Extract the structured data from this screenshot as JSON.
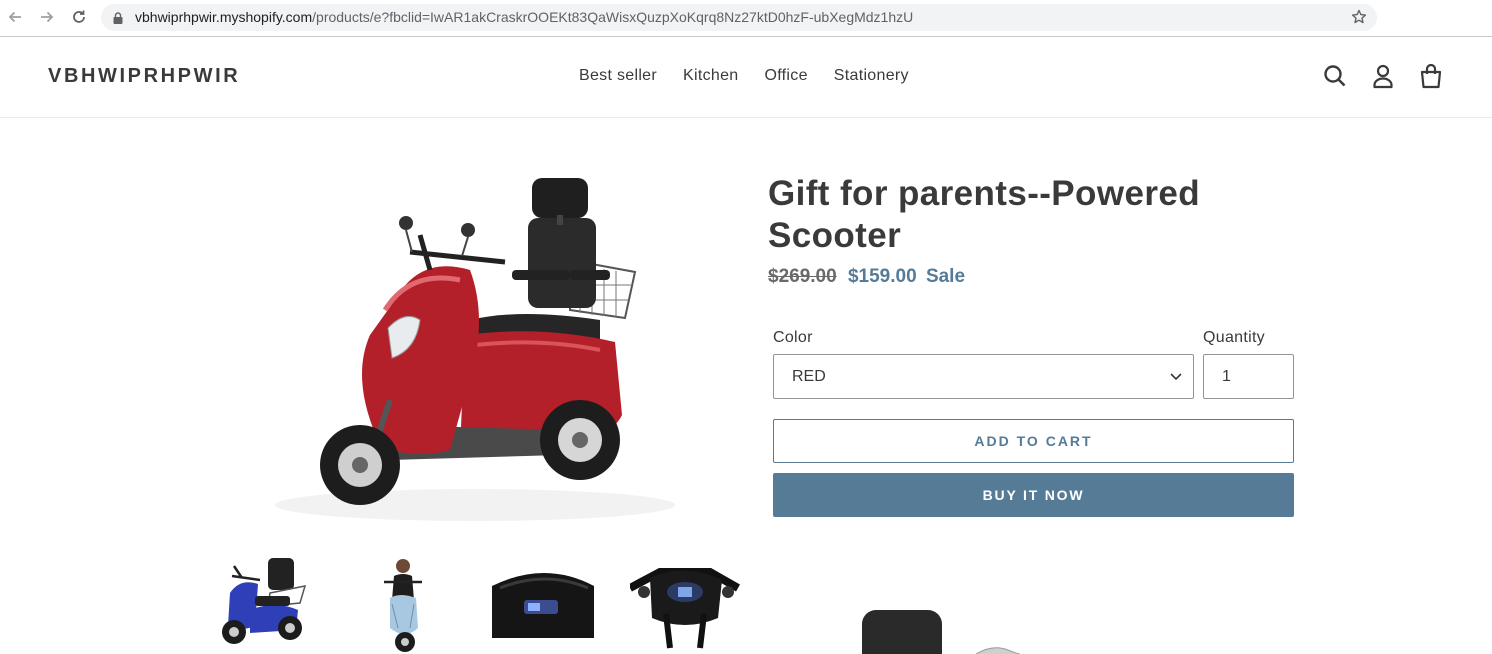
{
  "browser": {
    "url_host": "vbhwiprhpwir.myshopify.com",
    "url_path": "/products/e?fbclid=IwAR1akCraskrOOEKt83QaWisxQuzpXoKqrq8Nz27ktD0hzF-ubXegMdz1hzU",
    "icons": [
      "back-arrow-icon",
      "forward-arrow-icon",
      "reload-icon",
      "lock-icon",
      "bookmark-star-icon"
    ]
  },
  "header": {
    "logo": "VBHWIPRHPWIR",
    "nav": [
      "Best seller",
      "Kitchen",
      "Office",
      "Stationery"
    ],
    "icons": [
      "search-icon",
      "account-icon",
      "cart-icon"
    ]
  },
  "product": {
    "title": "Gift for parents--Powered Scooter",
    "price_old": "$269.00",
    "price_new": "$159.00",
    "sale_label": "Sale",
    "color_label": "Color",
    "color_value": "RED",
    "quantity_label": "Quantity",
    "quantity_value": "1",
    "add_to_cart": "ADD TO CART",
    "buy_now": "BUY IT NOW"
  },
  "media": {
    "main_image": "red three-wheel mobility scooter",
    "thumbnails": [
      "blue scooter",
      "rider on light blue scooter",
      "scooter dashboard display",
      "scooter handlebar console"
    ]
  },
  "colors": {
    "accent": "#557b97",
    "text": "#3a3a3a",
    "scooter_red": "#b3202a"
  }
}
